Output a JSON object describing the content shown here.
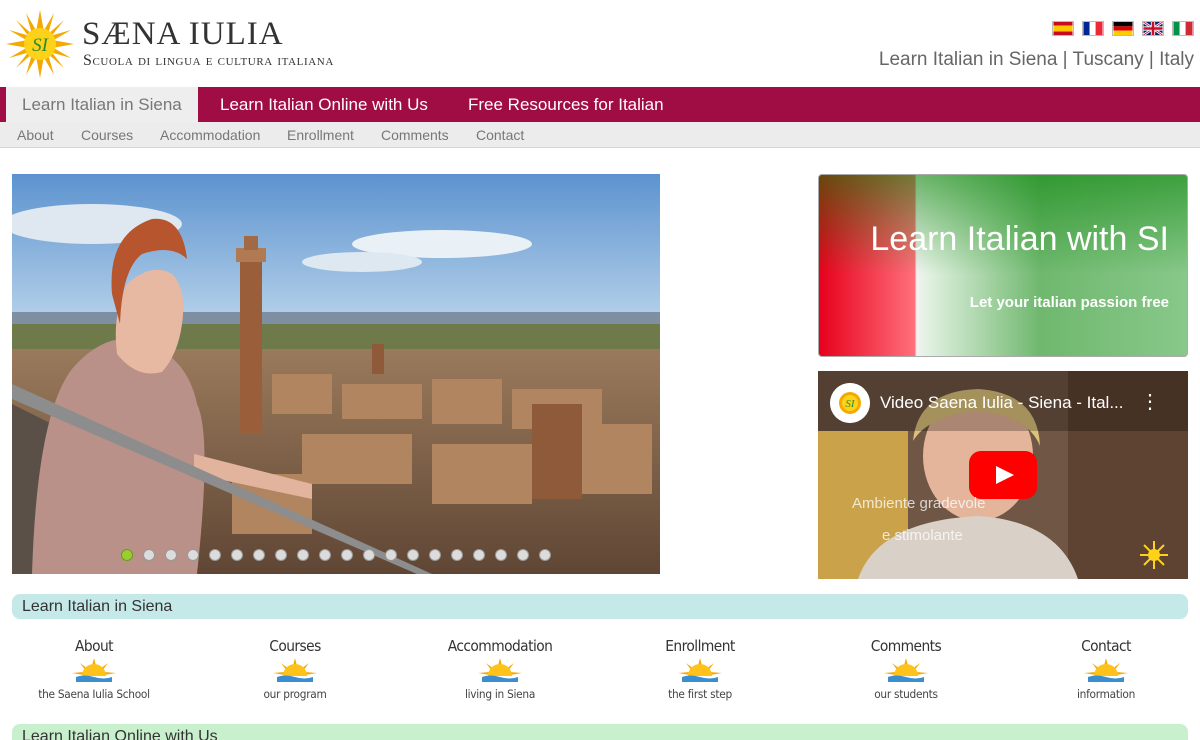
{
  "header": {
    "logo_text": "SI",
    "title": "SÆNA IULIA",
    "subtitle": "Scuola di lingua e cultura italiana",
    "tagline": "Learn Italian in Siena | Tuscany | Italy",
    "flags": [
      "spanish-flag-icon",
      "french-flag-icon",
      "german-flag-icon",
      "uk-flag-icon",
      "italian-flag-icon"
    ]
  },
  "main_nav": {
    "tabs": [
      {
        "label": "Learn Italian in Siena",
        "active": true
      },
      {
        "label": "Learn Italian Online with Us",
        "active": false
      },
      {
        "label": "Free Resources for Italian",
        "active": false
      }
    ]
  },
  "sub_nav": {
    "items": [
      "About",
      "Courses",
      "Accommodation",
      "Enrollment",
      "Comments",
      "Contact"
    ]
  },
  "slider": {
    "slide_count": 20,
    "active_index": 0
  },
  "promo": {
    "title": "Learn Italian with SI",
    "subtitle": "Let your italian passion free"
  },
  "video": {
    "title": "Video Saena Iulia - Siena - Ital...",
    "menu_icon": "more-vert-icon",
    "caption_line1": "Ambiente gradevole",
    "caption_line2": "e stimolante"
  },
  "sections": {
    "siena_title": "Learn Italian in Siena",
    "online_title": "Learn Italian Online with Us"
  },
  "siena_links": [
    {
      "title": "About",
      "subtitle": "the Saena Iulia School"
    },
    {
      "title": "Courses",
      "subtitle": "our program"
    },
    {
      "title": "Accommodation",
      "subtitle": "living in Siena"
    },
    {
      "title": "Enrollment",
      "subtitle": "the first step"
    },
    {
      "title": "Comments",
      "subtitle": "our students"
    },
    {
      "title": "Contact",
      "subtitle": "information"
    }
  ],
  "colors": {
    "nav_bg": "#a00c44",
    "section_siena_bg": "#c5e8e8",
    "section_online_bg": "#c9f0cc",
    "dot_active": "#9acd32"
  }
}
